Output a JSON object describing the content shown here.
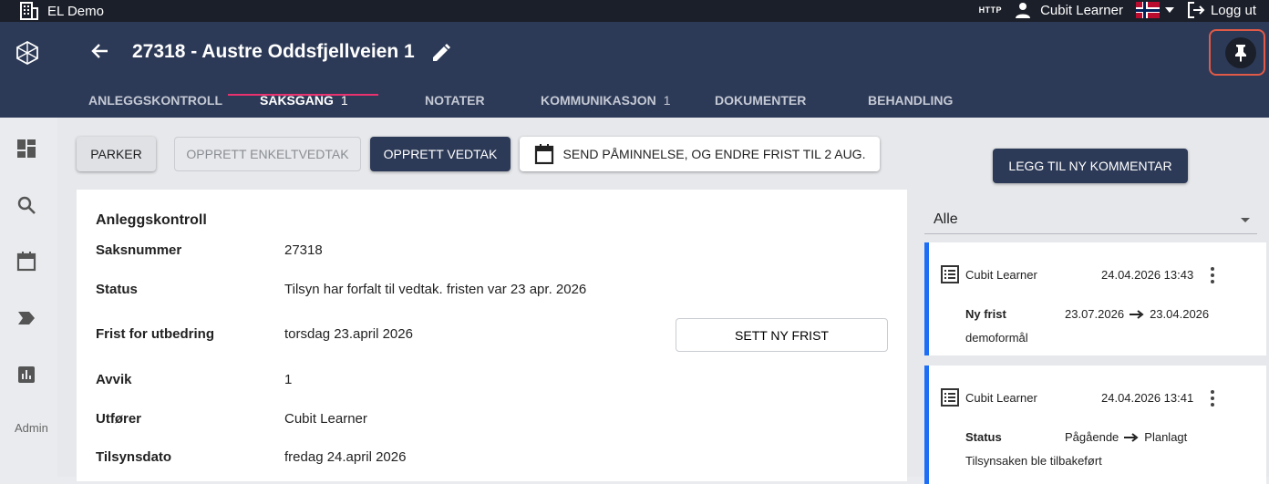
{
  "topbar": {
    "app_name": "EL Demo",
    "http_label": "HTTP",
    "user_name": "Cubit Learner",
    "logout_label": "Logg ut"
  },
  "header": {
    "title": "27318 - Austre Oddsfjellveien 1",
    "tabs": [
      {
        "label": "ANLEGGSKONTROLL",
        "badge": ""
      },
      {
        "label": "SAKSGANG",
        "badge": "1"
      },
      {
        "label": "NOTATER",
        "badge": ""
      },
      {
        "label": "KOMMUNIKASJON",
        "badge": "1"
      },
      {
        "label": "DOKUMENTER",
        "badge": ""
      },
      {
        "label": "BEHANDLING",
        "badge": ""
      }
    ],
    "active_tab": "SAKSGANG"
  },
  "sidebar": {
    "admin_label": "Admin",
    "icons": [
      "dashboard-icon",
      "search-icon",
      "calendar-icon",
      "label-icon",
      "chart-icon"
    ]
  },
  "actions": {
    "parker": "PARKER",
    "enkeltvedtak": "OPPRETT ENKELTVEDTAK",
    "vedtak": "OPPRETT VEDTAK",
    "send": "SEND PÅMINNELSE, OG ENDRE FRIST TIL 2 AUG.",
    "kommentar": "LEGG TIL NY KOMMENTAR"
  },
  "details": {
    "heading": "Anleggskontroll",
    "rows": [
      {
        "label": "Saksnummer",
        "value": "27318"
      },
      {
        "label": "Status",
        "value": "Tilsyn har forfalt til vedtak. fristen var 23 apr. 2026"
      },
      {
        "label": "Frist for utbedring",
        "value": "torsdag 23.april 2026"
      },
      {
        "label": "Avvik",
        "value": "1"
      },
      {
        "label": "Utfører",
        "value": "Cubit Learner"
      },
      {
        "label": "Tilsynsdato",
        "value": "fredag 24.april 2026"
      }
    ],
    "sett_ny_frist": "SETT NY FRIST"
  },
  "log": {
    "filter": "Alle",
    "entries": [
      {
        "user": "Cubit Learner",
        "date": "24.04.2026 13:43",
        "field": "Ny frist",
        "from": "23.07.2026",
        "to": "23.04.2026",
        "desc": "demoformål"
      },
      {
        "user": "Cubit Learner",
        "date": "24.04.2026 13:41",
        "field": "Status",
        "from": "Pågående",
        "to": "Planlagt",
        "desc": "Tilsynsaken ble tilbakeført"
      }
    ]
  },
  "colors": {
    "header": "#2d3a57",
    "topbar": "#1b1f2a",
    "accent": "#e8326f",
    "entry_border": "#1e6ef5",
    "highlight": "#e05a47"
  }
}
